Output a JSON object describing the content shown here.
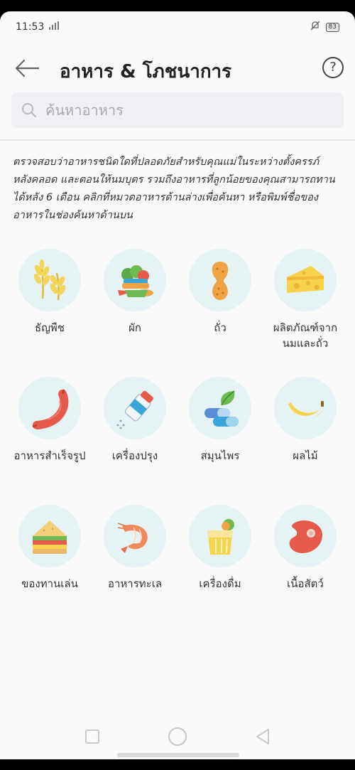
{
  "status_bar": {
    "time": "11:53",
    "battery": "83"
  },
  "header": {
    "title": "อาหาร & โภชนาการ",
    "help": "?"
  },
  "search": {
    "placeholder": "ค้นหาอาหาร"
  },
  "description": "ตรวจสอบว่าอาหารชนิดใดที่ปลอดภัยสำหรับคุณแม่ในระหว่างตั้งครรภ์ หลังคลอด และตอนให้นมบุตร รวมถึงอาหารที่ลูกน้อยของคุณสามารถทานได้หลัง 6 เดือน คลิกที่หมวดอาหารด้านล่างเพื่อค้นหา หรือพิมพ์ชื่อของอาหารในช่องค้นหาด้านบน",
  "categories": [
    {
      "label": "ธัญพืช",
      "icon": "grain-icon"
    },
    {
      "label": "ผัก",
      "icon": "vegetables-icon"
    },
    {
      "label": "ถั่ว",
      "icon": "peanut-icon"
    },
    {
      "label": "ผลิตภัณฑ์จากนมและถั่ว",
      "icon": "cheese-icon"
    },
    {
      "label": "อาหารสำเร็จรูป",
      "icon": "sausage-icon"
    },
    {
      "label": "เครื่องปรุง",
      "icon": "salt-shaker-icon"
    },
    {
      "label": "สมุนไพร",
      "icon": "herbs-icon"
    },
    {
      "label": "ผลไม้",
      "icon": "banana-icon"
    },
    {
      "label": "ของทานเล่น",
      "icon": "sandwich-icon"
    },
    {
      "label": "อาหารทะเล",
      "icon": "shrimp-icon"
    },
    {
      "label": "เครื่องดื่ม",
      "icon": "drink-icon"
    },
    {
      "label": "เนื้อสัตว์",
      "icon": "meat-icon"
    }
  ],
  "colors": {
    "icon_bg": "#e6f3f4",
    "accent_orange": "#f0a345",
    "yellow": "#f7d24a",
    "red": "#e55a4a"
  }
}
